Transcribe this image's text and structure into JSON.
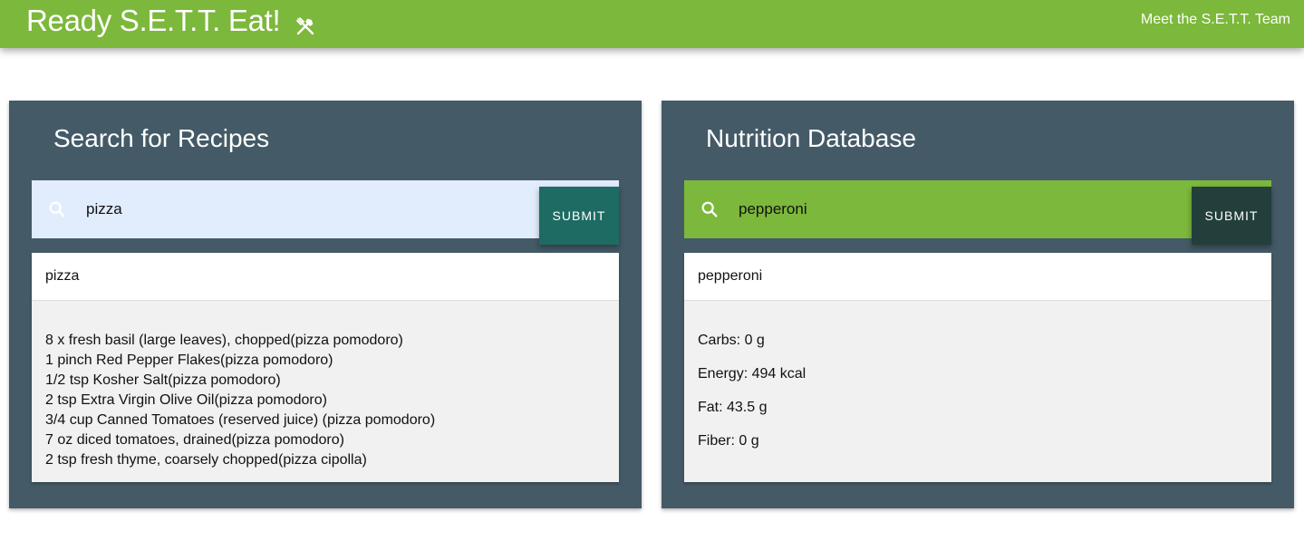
{
  "navbar": {
    "brand": "Ready S.E.T.T. Eat!",
    "brand_icon": "utensils-icon",
    "team_link": "Meet the S.E.T.T. Team",
    "color": "#7cb83b"
  },
  "recipes_panel": {
    "title": "Search for Recipes",
    "search_icon": "search-icon",
    "search_value": "pizza",
    "submit_label": "SUBMIT",
    "result_title": "pizza",
    "ingredients": [
      "8 x fresh basil (large leaves), chopped(pizza pomodoro)",
      "1 pinch Red Pepper Flakes(pizza pomodoro)",
      "1/2 tsp Kosher Salt(pizza pomodoro)",
      "2 tsp Extra Virgin Olive Oil(pizza pomodoro)",
      "3/4 cup Canned Tomatoes (reserved juice) (pizza pomodoro)",
      "7 oz diced tomatoes, drained(pizza pomodoro)",
      "2 tsp fresh thyme, coarsely chopped(pizza cipolla)"
    ]
  },
  "nutrition_panel": {
    "title": "Nutrition Database",
    "search_icon": "search-icon",
    "search_value": "pepperoni",
    "submit_label": "SUBMIT",
    "result_title": "pepperoni",
    "nutrients": [
      "Carbs: 0 g",
      "Energy: 494 kcal",
      "Fat: 43.5 g",
      "Fiber: 0 g"
    ]
  },
  "colors": {
    "panel_bg": "#445a67",
    "recipe_search_bg": "#e1ecfc",
    "nutrition_search_bg": "#7cb83b",
    "recipe_submit_bg": "#1e6b63",
    "nutrition_submit_bg": "#233f3c"
  }
}
